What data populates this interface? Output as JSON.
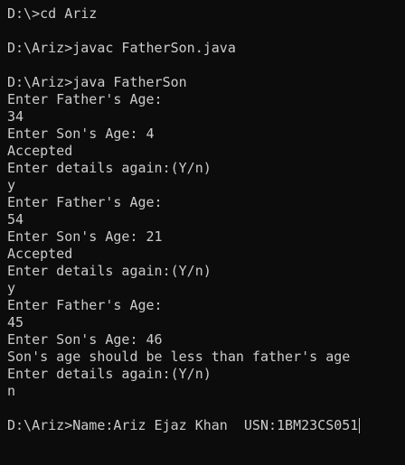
{
  "terminal": {
    "lines": [
      "D:\\>cd Ariz",
      "",
      "D:\\Ariz>javac FatherSon.java",
      "",
      "D:\\Ariz>java FatherSon",
      "Enter Father's Age:",
      "34",
      "Enter Son's Age: 4",
      "Accepted",
      "Enter details again:(Y/n)",
      "y",
      "Enter Father's Age:",
      "54",
      "Enter Son's Age: 21",
      "Accepted",
      "Enter details again:(Y/n)",
      "y",
      "Enter Father's Age:",
      "45",
      "Enter Son's Age: 46",
      "Son's age should be less than father's age",
      "Enter details again:(Y/n)",
      "n",
      "",
      "D:\\Ariz>Name:Ariz Ejaz Khan  USN:1BM23CS051"
    ]
  },
  "colors": {
    "background": "#0c0c0c",
    "text": "#cccccc"
  }
}
